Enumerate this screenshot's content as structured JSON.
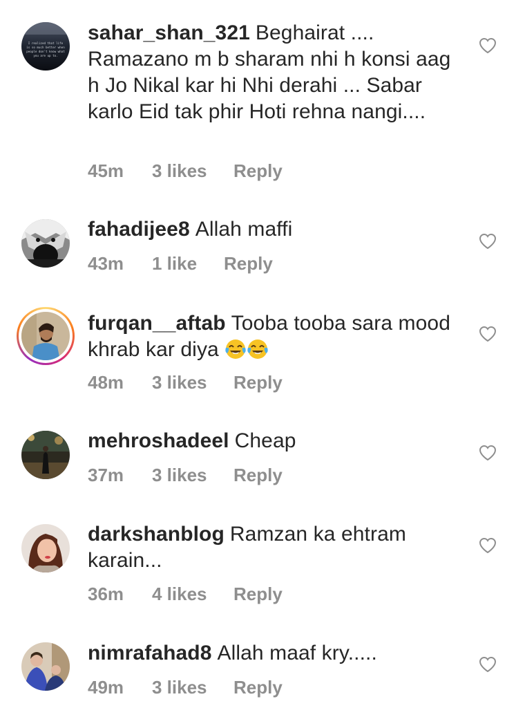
{
  "comments": [
    {
      "username": "sahar_shan_321",
      "text": "Beghairat .... Ramazano m b sharam nhi h konsi aag h Jo Nikal kar hi Nhi derahi ... Sabar karlo Eid tak phir Hoti rehna nangi....",
      "time": "45m",
      "likes": "3 likes",
      "reply": "Reply",
      "avatar_text": "I realized that life is so much better when people don't know what you are up to."
    },
    {
      "username": "fahadijee8",
      "text": "Allah maffi",
      "time": "43m",
      "likes": "1 like",
      "reply": "Reply"
    },
    {
      "username": "furqan__aftab",
      "text": "Tooba tooba sara mood khrab kar diya",
      "time": "48m",
      "likes": "3 likes",
      "reply": "Reply",
      "emojis": [
        "face-with-tears-of-joy-icon",
        "face-with-tears-of-joy-icon"
      ]
    },
    {
      "username": "mehroshadeel",
      "text": "Cheap",
      "time": "37m",
      "likes": "3 likes",
      "reply": "Reply"
    },
    {
      "username": "darkshanblog",
      "text": "Ramzan ka ehtram karain...",
      "time": "36m",
      "likes": "4 likes",
      "reply": "Reply"
    },
    {
      "username": "nimrafahad8",
      "text": "Allah maaf kry.....",
      "time": "49m",
      "likes": "3 likes",
      "reply": "Reply"
    }
  ]
}
